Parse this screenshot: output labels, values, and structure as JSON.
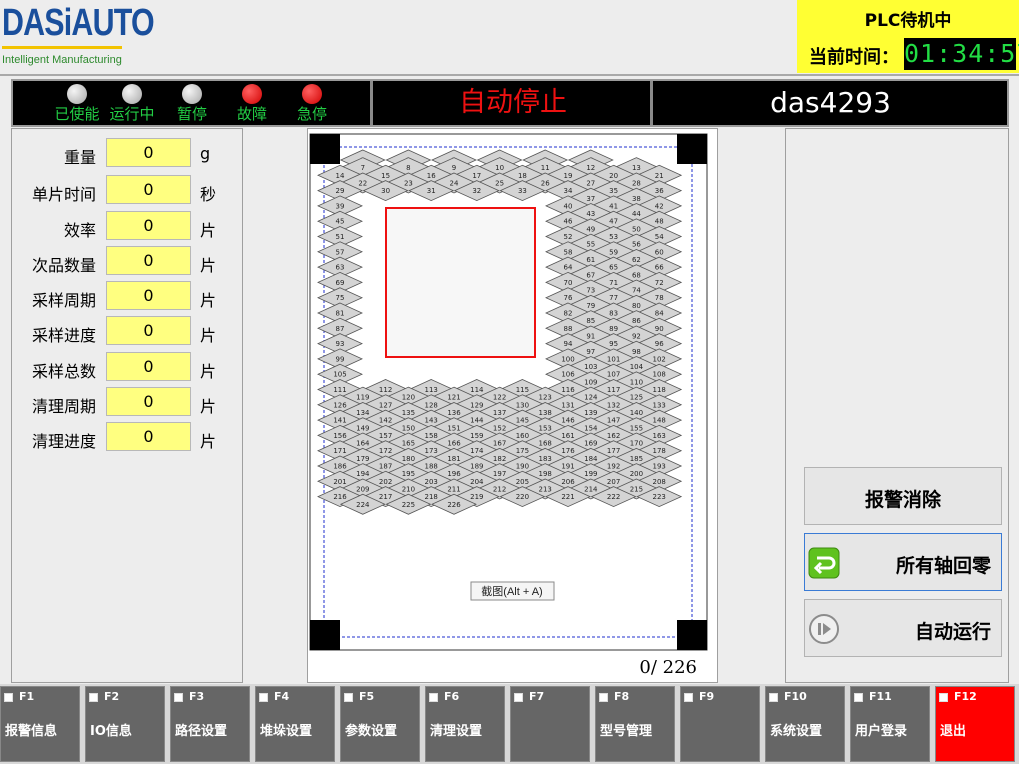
{
  "logo": {
    "brand": "DASiAUTO",
    "tagline": "Intelligent Manufacturing"
  },
  "plc": {
    "status": "PLC待机中",
    "time_label": "当前时间：",
    "time": "01:34:57"
  },
  "indicators": [
    {
      "label": "已使能",
      "color": "grey"
    },
    {
      "label": "运行中",
      "color": "grey"
    },
    {
      "label": "暂停",
      "color": "grey"
    },
    {
      "label": "故障",
      "color": "red"
    },
    {
      "label": "急停",
      "color": "red"
    }
  ],
  "mode": "自动停止",
  "machine_id": "das4293",
  "params": [
    {
      "label": "重量",
      "value": "0",
      "unit": "g"
    },
    {
      "label": "单片时间",
      "value": "0",
      "unit": "秒"
    },
    {
      "label": "效率",
      "value": "0",
      "unit": "片"
    },
    {
      "label": "次品数量",
      "value": "0",
      "unit": "片"
    },
    {
      "label": "采样周期",
      "value": "0",
      "unit": "片"
    },
    {
      "label": "采样进度",
      "value": "0",
      "unit": "片"
    },
    {
      "label": "采样总数",
      "value": "0",
      "unit": "片"
    },
    {
      "label": "清理周期",
      "value": "0",
      "unit": "片"
    },
    {
      "label": "清理进度",
      "value": "0",
      "unit": "片"
    }
  ],
  "tray": {
    "count_done": "0",
    "count_total": "226",
    "tooltip": "截图(Alt + A)"
  },
  "actions": {
    "reset_alarm": "报警消除",
    "home_all": "所有轴回零",
    "auto_run": "自动运行"
  },
  "colors": {
    "plc_bg": "#ffff33",
    "clock_fg": "#22dd44",
    "mode_fg": "#ee1111",
    "value_bg": "#ffff80",
    "exit_bg": "#ff0000"
  },
  "fkeys": [
    {
      "key": "F1",
      "label": "报警信息"
    },
    {
      "key": "F2",
      "label": "IO信息"
    },
    {
      "key": "F3",
      "label": "路径设置"
    },
    {
      "key": "F4",
      "label": "堆垛设置"
    },
    {
      "key": "F5",
      "label": "参数设置"
    },
    {
      "key": "F6",
      "label": "清理设置"
    },
    {
      "key": "F7",
      "label": ""
    },
    {
      "key": "F8",
      "label": "型号管理"
    },
    {
      "key": "F9",
      "label": ""
    },
    {
      "key": "F10",
      "label": "系统设置"
    },
    {
      "key": "F11",
      "label": "用户登录"
    },
    {
      "key": "F12",
      "label": "退出"
    }
  ]
}
